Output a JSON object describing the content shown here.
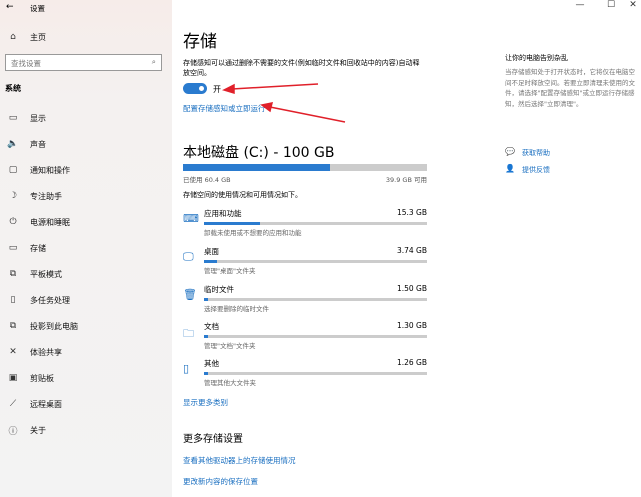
{
  "window": {
    "title": "设置",
    "back": "←",
    "minimize": "—",
    "maximize": "☐",
    "close": "✕"
  },
  "sidebar": {
    "home": "主页",
    "search_placeholder": "查找设置",
    "section": "系统",
    "items": [
      {
        "label": "显示",
        "icon": "▭"
      },
      {
        "label": "声音",
        "icon": "🔈"
      },
      {
        "label": "通知和操作",
        "icon": "▢"
      },
      {
        "label": "专注助手",
        "icon": "☽"
      },
      {
        "label": "电源和睡眠",
        "icon": "⏻"
      },
      {
        "label": "存储",
        "icon": "▭"
      },
      {
        "label": "平板模式",
        "icon": "⧉"
      },
      {
        "label": "多任务处理",
        "icon": "▯"
      },
      {
        "label": "投影到此电脑",
        "icon": "⧉"
      },
      {
        "label": "体验共享",
        "icon": "✕"
      },
      {
        "label": "剪贴板",
        "icon": "▣"
      },
      {
        "label": "远程桌面",
        "icon": "⟋"
      },
      {
        "label": "关于",
        "icon": "ⓘ"
      }
    ]
  },
  "main": {
    "title": "存储",
    "description": "存储感知可以通过删除不需要的文件(例如临时文件和回收站中的内容)自动释放空间。",
    "toggle_label": "开",
    "toggle_on": true,
    "configure_link": "配置存储感知或立即运行",
    "disk_title": "本地磁盘 (C:) - 100 GB",
    "disk_used": "已使用 60.4 GB",
    "disk_free": "39.9 GB 可用",
    "disk_used_fraction": 0.604,
    "usage_desc": "存储空间的使用情况和可用情况如下。",
    "items": [
      {
        "name": "应用和功能",
        "size": "15.3 GB",
        "sub": "卸载未使用或不想要的应用和功能",
        "fraction": 0.25,
        "icon": "⌨"
      },
      {
        "name": "桌面",
        "size": "3.74 GB",
        "sub": "管理\"桌面\"文件夹",
        "fraction": 0.06,
        "icon": "🖵"
      },
      {
        "name": "临时文件",
        "size": "1.50 GB",
        "sub": "选择要删除的临时文件",
        "fraction": 0.02,
        "icon": "🗑"
      },
      {
        "name": "文档",
        "size": "1.30 GB",
        "sub": "管理\"文档\"文件夹",
        "fraction": 0.02,
        "icon": "🗀"
      },
      {
        "name": "其他",
        "size": "1.26 GB",
        "sub": "管理其他大文件夹",
        "fraction": 0.02,
        "icon": "▯"
      }
    ],
    "show_more": "显示更多类别",
    "more_title": "更多存储设置",
    "more_links": [
      "查看其他驱动器上的存储使用情况",
      "更改新内容的保存位置"
    ]
  },
  "right": {
    "title": "让你的电脑告别杂乱",
    "text": "当存储感知处于打开状态时，它将仅在电脑空间不足时释放空间。若要立即清理未使用的文件，请选择\"配置存储感知\"或立即运行存储感知，然后选择\"立即清理\"。",
    "help": "获取帮助",
    "feedback": "提供反馈"
  },
  "colors": {
    "accent": "#2a7bcf",
    "arrow": "#e0202a"
  }
}
